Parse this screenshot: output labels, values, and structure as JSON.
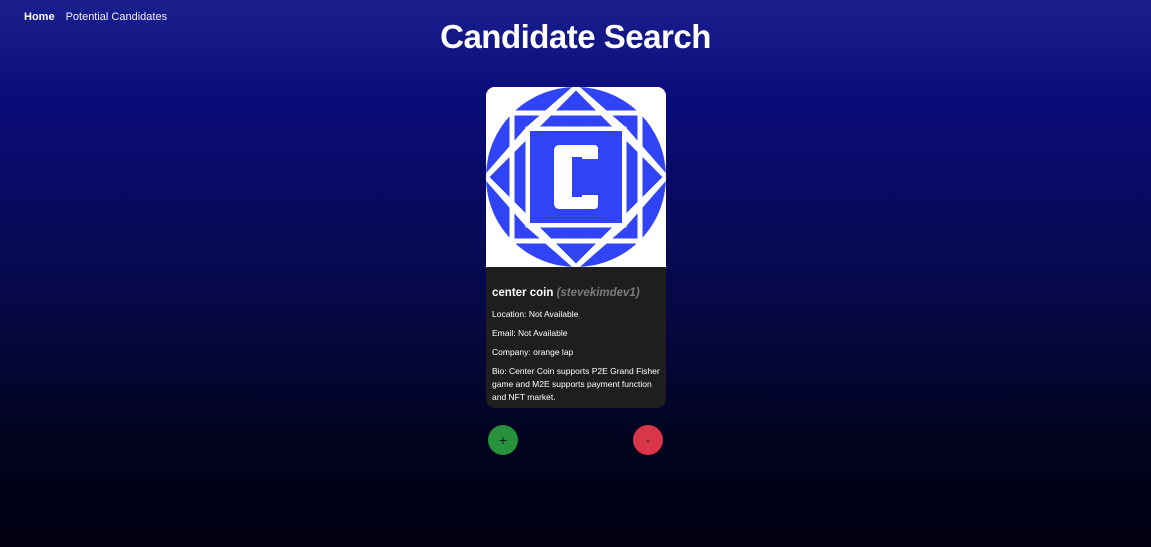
{
  "nav": {
    "home": "Home",
    "potential": "Potential Candidates"
  },
  "page": {
    "title": "Candidate Search"
  },
  "candidate": {
    "name": "center coin",
    "login": "(stevekimdev1)",
    "location": "Location: Not Available",
    "email": "Email: Not Available",
    "company": "Company: orange lap",
    "bio": "Bio: Center Coin supports P2E Grand Fisher game and M2E supports payment function and NFT market.",
    "avatar_icon": "center-coin-logo",
    "avatar_letter": "C",
    "avatar_color": "#3044f5"
  },
  "actions": {
    "add_label": "+",
    "add_color": "#27913c",
    "remove_label": "-",
    "remove_color": "#d9364a"
  }
}
